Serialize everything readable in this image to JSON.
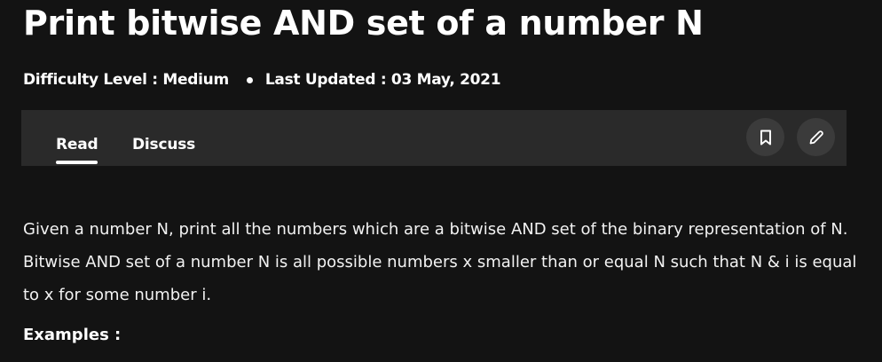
{
  "article": {
    "title": "Print bitwise AND set of a number N",
    "difficulty": "Difficulty Level : Medium",
    "last_updated": "Last Updated : 03 May, 2021"
  },
  "tabs": {
    "read": "Read",
    "discuss": "Discuss",
    "active": "Read"
  },
  "icons": {
    "bookmark": "bookmark-icon",
    "edit": "pencil-icon"
  },
  "body": {
    "paragraph": "Given a number N, print all the numbers which are a bitwise AND set of the binary representation of N. Bitwise AND set of a number N is all possible numbers x smaller than or equal N such that N & i is equal to x for some number i.",
    "examples_heading": "Examples :"
  },
  "colors": {
    "background": "#131313",
    "tabbar": "#2a2a2a",
    "icon_button": "#3b3b3b",
    "text": "#ffffff"
  }
}
